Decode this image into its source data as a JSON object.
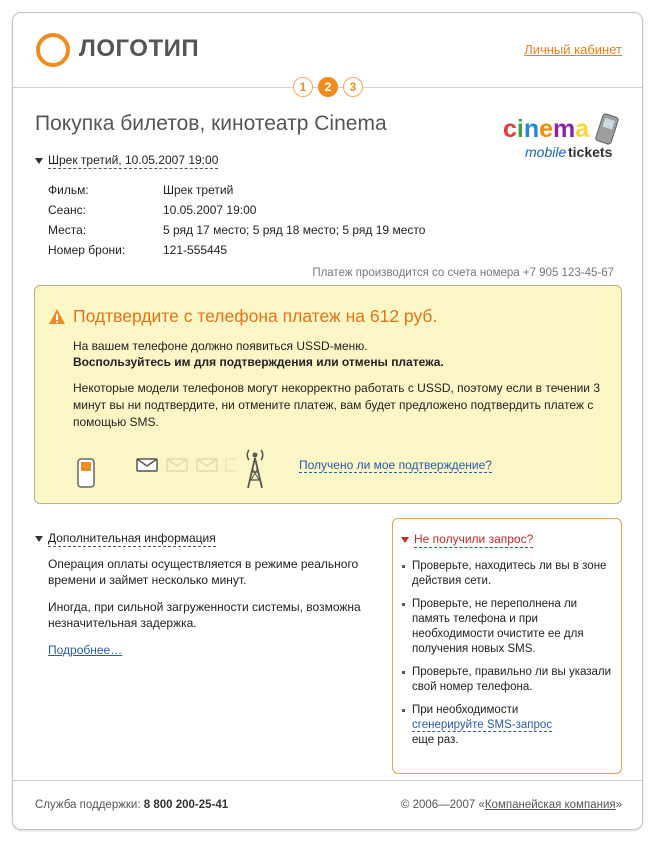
{
  "header": {
    "logo_text": "ЛОГОТИП",
    "cabinet_link": "Личный кабинет",
    "steps": [
      "1",
      "2",
      "3"
    ],
    "active_step": "2"
  },
  "page": {
    "title": "Покупка билетов, кинотеатр Cinema",
    "brand": {
      "word_cinema": "cinema",
      "word_mobile": "mobile",
      "word_tickets": "tickets"
    }
  },
  "order": {
    "toggle_label": "Шрек третий, 10.05.2007 19:00",
    "rows": [
      {
        "key": "Фильм:",
        "value": "Шрек третий"
      },
      {
        "key": "Сеанс:",
        "value": "10.05.2007 19:00"
      },
      {
        "key": "Места:",
        "value": "5 ряд 17 место; 5 ряд 18 место; 5 ряд 19 место"
      },
      {
        "key": "Номер брони:",
        "value": "121-555445"
      }
    ],
    "payment_note": "Платеж производится со счета номера +7 905 123-45-67"
  },
  "confirm": {
    "title": "Подтвердите с телефона платеж на 612 руб.",
    "line1": "На вашем телефоне должно появиться USSD-меню.",
    "line2": "Воспользуйтесь им для подтверждения или отмены платежа.",
    "warning": "Некоторые модели телефонов могут некорректно работать с USSD, поэтому если в течении 3 минут вы ни подтвердите, ни отмените платеж, вам будет предложено подтвердить платеж с помощью SMS.",
    "status_link": "Получено ли мое подтверждение?"
  },
  "additional": {
    "toggle_label": "Дополнительная информация",
    "p1": "Операция оплаты осуществляется в режиме реального времени и займет несколько минут.",
    "p2": "Иногда, при сильной загруженности системы, возможна незначительная задержка.",
    "more_link": "Подробнее…"
  },
  "side": {
    "title": "Не получили запрос?",
    "items": [
      "Проверьте, находитесь ли вы в зоне действия сети.",
      "Проверьте, не переполнена ли память телефона и при необходимости очистите ее для получения новых SMS.",
      "Проверьте, правильно ли вы указали свой номер телефона."
    ],
    "last_item_prefix": "При необходимости",
    "last_item_link": "сгенерируйте SMS-запрос",
    "last_item_suffix": "еще раз."
  },
  "footer": {
    "support_label": "Служба поддержки:",
    "support_phone": "8 800 200-25-41",
    "copyright": "© 2006—2007",
    "company_open": "«",
    "company_name": "Компанейская компания",
    "company_close": "»"
  },
  "colors": {
    "accent": "#f08c1e",
    "panel_bg": "#fbf6c6",
    "link": "#2a5aa8",
    "alert": "#c62828"
  }
}
